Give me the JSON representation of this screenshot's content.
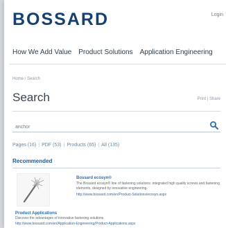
{
  "header": {
    "logo_text": "BOSSARD",
    "login_label": "Login"
  },
  "nav": {
    "items": [
      {
        "label": "How We Add Value"
      },
      {
        "label": "Product Solutions"
      },
      {
        "label": "Application Engineering"
      }
    ]
  },
  "breadcrumb": "Home / Search",
  "page_title": "Search",
  "toolbar_text": "Print | Share",
  "search": {
    "value": "anchor",
    "placeholder": ""
  },
  "filters": [
    {
      "label": "Pages (16)"
    },
    {
      "label": "PDF (53)"
    },
    {
      "label": "Products (65)"
    },
    {
      "label": "All (135)"
    }
  ],
  "recommended": {
    "title": "Recommended",
    "results": [
      {
        "title": "Bossard ecosyn®",
        "text": "The Bossard ecosyn® line of fastening solutions: integrated high quality screws and fastening elements, designed by innovative engineering.",
        "link": "http://www.bossard.com/en/Product-Solutions/ecosyn.aspx"
      },
      {
        "title": "Product Applications",
        "text": "Discover the advantages of innovative fastening solutions",
        "link": "http://www.bossard.com/en/Application-Engineering/Product-Applications.aspx"
      }
    ]
  },
  "colors": {
    "brand": "#16406e",
    "link": "#2a6bb0"
  }
}
